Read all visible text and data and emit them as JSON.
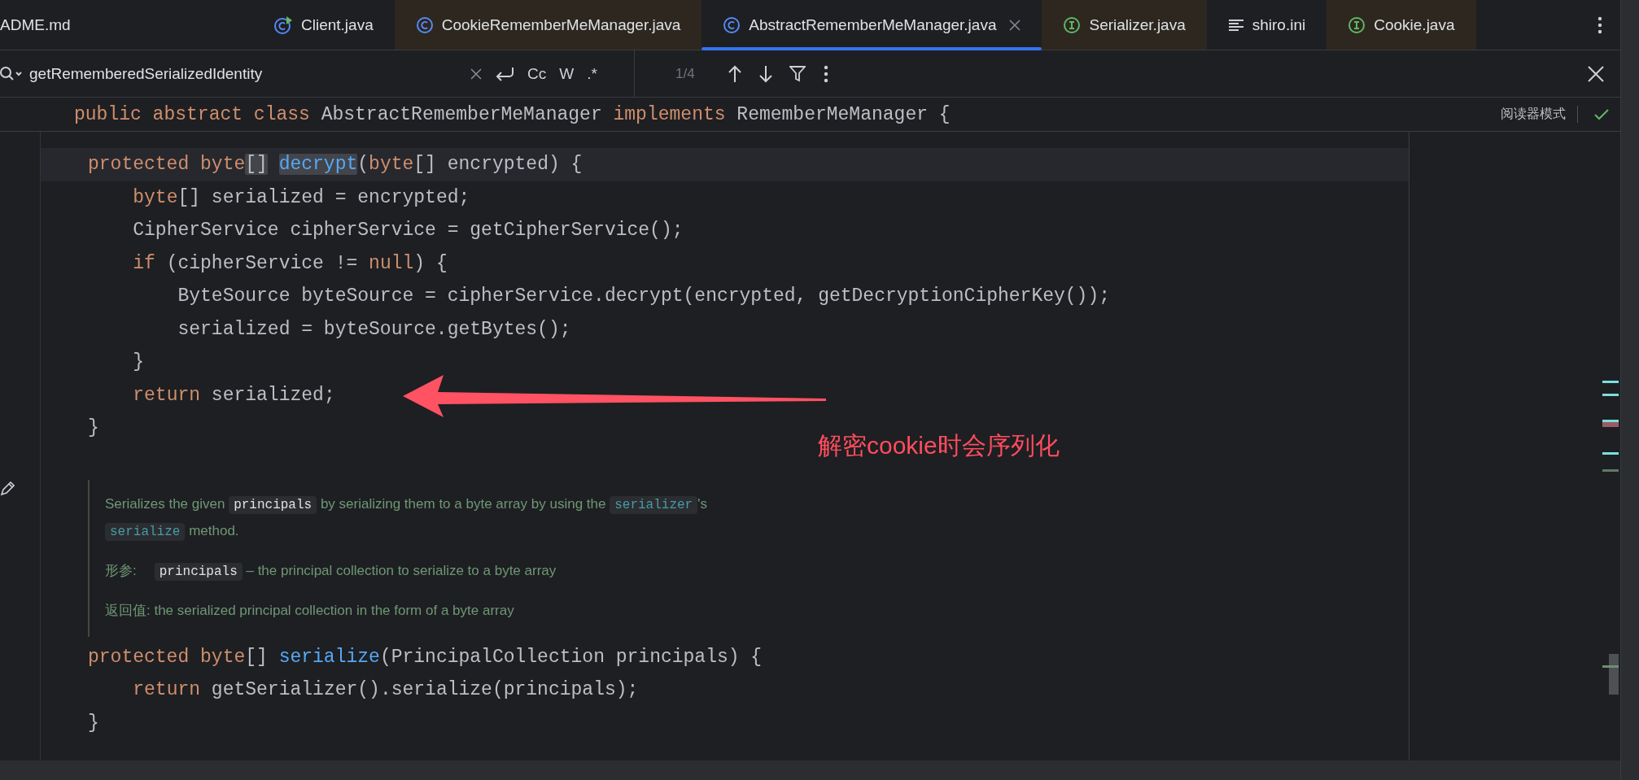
{
  "tabs": [
    {
      "label": "ADME.md",
      "kind": "markdown",
      "selected": false,
      "tinted": false
    },
    {
      "label": "Client.java",
      "kind": "runnable",
      "selected": false,
      "tinted": false
    },
    {
      "label": "CookieRememberMeManager.java",
      "kind": "class",
      "selected": false,
      "tinted": true
    },
    {
      "label": "AbstractRememberMeManager.java",
      "kind": "class",
      "selected": true,
      "tinted": false
    },
    {
      "label": "Serializer.java",
      "kind": "interface",
      "selected": false,
      "tinted": true
    },
    {
      "label": "shiro.ini",
      "kind": "text",
      "selected": false,
      "tinted": false
    },
    {
      "label": "Cookie.java",
      "kind": "interface",
      "selected": false,
      "tinted": true
    }
  ],
  "search": {
    "value": "getRememberedSerializedIdentity",
    "options": [
      "Cc",
      "W",
      ".*"
    ],
    "counter": "1/4"
  },
  "sticky_header": {
    "tokens": [
      {
        "text": "public abstract class ",
        "kind": "kw"
      },
      {
        "text": "AbstractRememberMeManager ",
        "kind": "plain"
      },
      {
        "text": "implements ",
        "kind": "kw"
      },
      {
        "text": "RememberMeManager {",
        "kind": "plain"
      }
    ],
    "reader_mode": "阅读器模式"
  },
  "blocks": [
    {
      "kind": "code",
      "lines": [
        {
          "current": true,
          "tokens": [
            {
              "text": "protected byte",
              "kind": "kw"
            },
            {
              "text": "[]",
              "kind": "plain-match"
            },
            {
              "text": " decrypt",
              "kind": "decl-match"
            },
            {
              "text": "(",
              "kind": "plain"
            },
            {
              "text": "byte",
              "kind": "kw"
            },
            {
              "text": "[] encrypted) {",
              "kind": "plain"
            }
          ]
        },
        {
          "current": false,
          "tokens": [
            {
              "text": "    byte",
              "kind": "kw"
            },
            {
              "text": "[] serialized = encrypted;",
              "kind": "plain"
            }
          ]
        },
        {
          "current": false,
          "tokens": [
            {
              "text": "    CipherService cipherService = getCipherService();",
              "kind": "plain"
            }
          ]
        },
        {
          "current": false,
          "tokens": [
            {
              "text": "    if",
              "kind": "kw"
            },
            {
              "text": " (cipherService != ",
              "kind": "plain"
            },
            {
              "text": "null",
              "kind": "kw"
            },
            {
              "text": ") {",
              "kind": "plain"
            }
          ]
        },
        {
          "current": false,
          "tokens": [
            {
              "text": "        ByteSource byteSource = cipherService.decrypt(encrypted, getDecryptionCipherKey());",
              "kind": "plain"
            }
          ]
        },
        {
          "current": false,
          "tokens": [
            {
              "text": "        serialized = byteSource.getBytes();",
              "kind": "plain"
            }
          ]
        },
        {
          "current": false,
          "tokens": [
            {
              "text": "    }",
              "kind": "plain"
            }
          ]
        },
        {
          "current": false,
          "tokens": [
            {
              "text": "    return",
              "kind": "kw"
            },
            {
              "text": " serialized;",
              "kind": "plain"
            }
          ]
        },
        {
          "current": false,
          "tokens": [
            {
              "text": "}",
              "kind": "plain"
            }
          ]
        }
      ]
    },
    {
      "kind": "doc",
      "rows": [
        {
          "kind": "text",
          "segments": [
            {
              "text": "Serializes the given ",
              "kind": "text"
            },
            {
              "text": "principals",
              "kind": "code"
            },
            {
              "text": " by serializing them to a byte array by using the ",
              "kind": "text"
            },
            {
              "text": "serializer",
              "kind": "ref"
            },
            {
              "text": "'s ",
              "kind": "text"
            },
            {
              "text": "serialize",
              "kind": "ref"
            },
            {
              "text": " method.",
              "kind": "text"
            }
          ]
        },
        {
          "kind": "param",
          "label": "形参:",
          "segments": [
            {
              "text": "principals",
              "kind": "code"
            },
            {
              "text": " – the principal collection to serialize to a byte array",
              "kind": "text"
            }
          ]
        },
        {
          "kind": "text",
          "segments": [
            {
              "text": "返回值: the serialized principal collection in the form of a byte array",
              "kind": "text"
            }
          ]
        }
      ]
    },
    {
      "kind": "code",
      "lines": [
        {
          "current": false,
          "tokens": [
            {
              "text": "protected byte",
              "kind": "kw"
            },
            {
              "text": "[] ",
              "kind": "plain"
            },
            {
              "text": "serialize",
              "kind": "decl"
            },
            {
              "text": "(PrincipalCollection principals) {",
              "kind": "plain"
            }
          ]
        },
        {
          "current": false,
          "tokens": [
            {
              "text": "    return",
              "kind": "kw"
            },
            {
              "text": " getSerializer().serialize(principals);",
              "kind": "plain"
            }
          ]
        },
        {
          "current": false,
          "tokens": [
            {
              "text": "}",
              "kind": "plain"
            }
          ]
        }
      ]
    }
  ],
  "annotation": {
    "text": "解密cookie时会序列化"
  }
}
